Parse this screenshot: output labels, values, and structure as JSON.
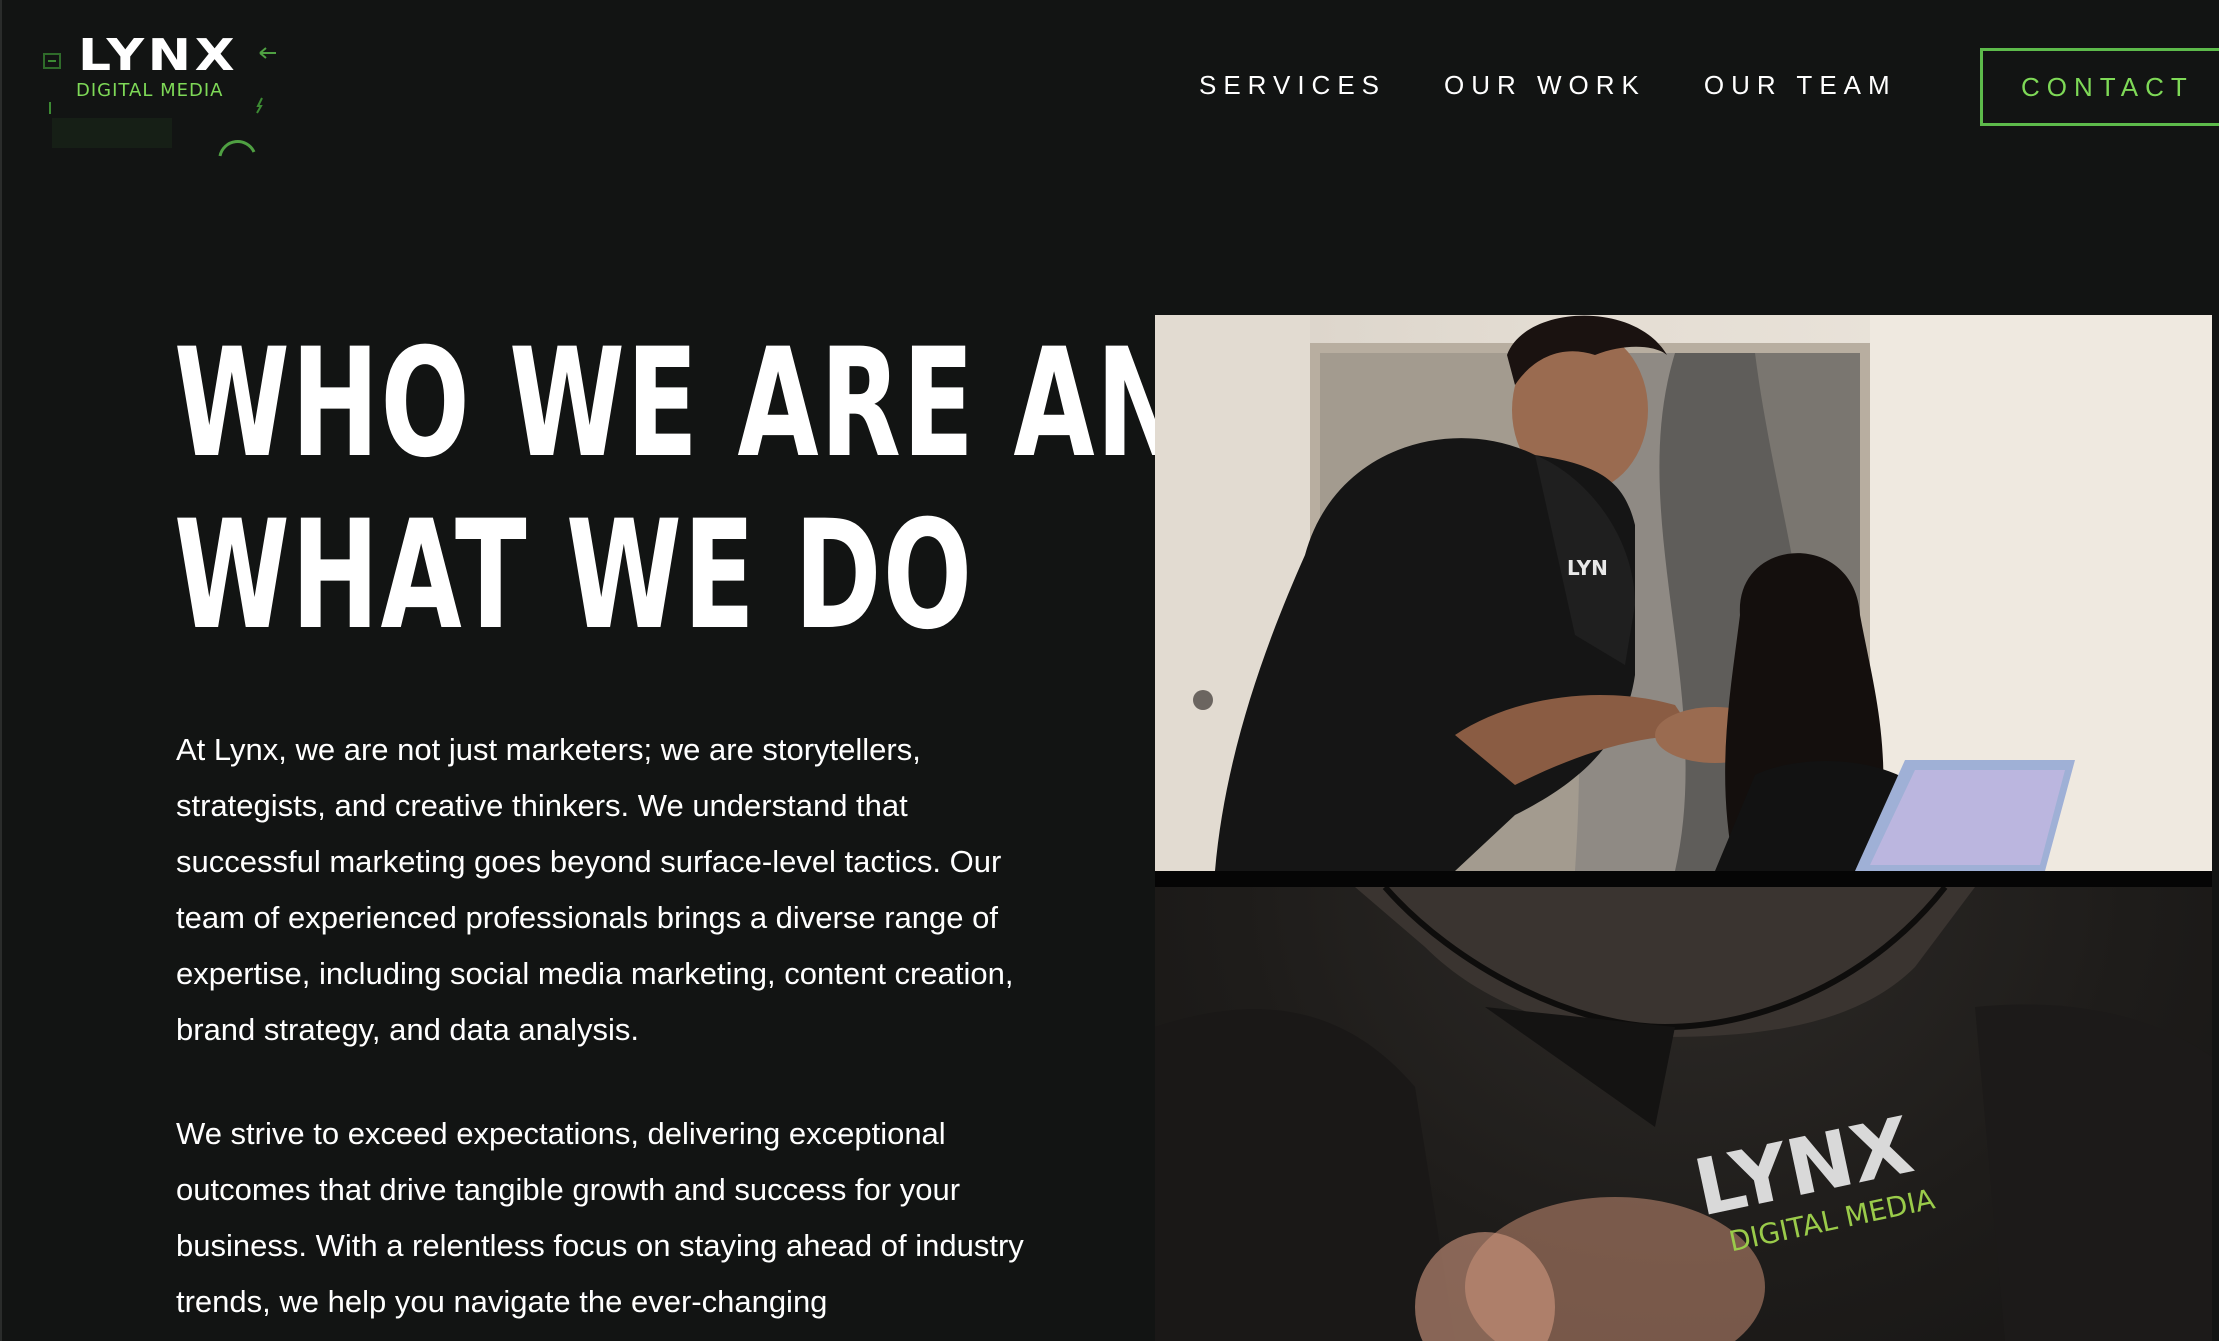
{
  "logo": {
    "wordmark": "LYNX",
    "subtitle": "DIGITAL MEDIA"
  },
  "nav": {
    "items": [
      {
        "label": "SERVICES"
      },
      {
        "label": "OUR WORK"
      },
      {
        "label": "OUR TEAM"
      }
    ],
    "contact_label": "CONTACT"
  },
  "hero": {
    "title_line_1": "WHO WE ARE AND",
    "title_line_2": "WHAT WE DO",
    "paragraph_1": "At Lynx, we are not just marketers; we are storytellers, strategists, and creative thinkers. We understand that successful marketing goes beyond surface-level tactics. Our team of experienced professionals brings a diverse range of expertise, including social media marketing, content creation, brand strategy, and data analysis.",
    "paragraph_2": "We strive to exceed expectations, delivering exceptional outcomes that drive tangible growth and success for your business. With a relentless focus on staying ahead of industry trends, we help you navigate the ever-changing"
  },
  "photos": {
    "shirt_logo_word": "LYNX",
    "shirt_logo_sub": "DIGITAL MEDIA",
    "small_shirt_logo": "LYN"
  },
  "colors": {
    "background": "#121413",
    "accent_green": "#7ed957",
    "border_green": "#5dbb4b",
    "text": "#ffffff"
  }
}
